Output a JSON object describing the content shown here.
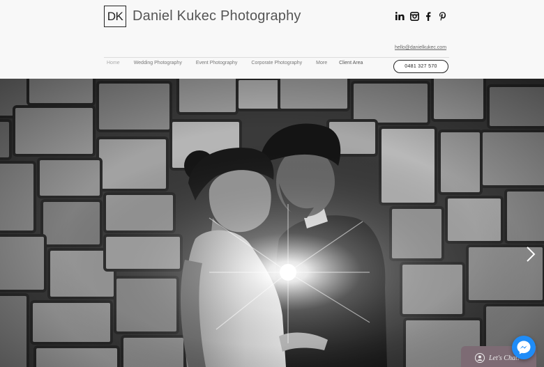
{
  "header": {
    "logo_text": "DK",
    "site_title": "Daniel Kukec Photography",
    "email": "hello@danielkukec.com",
    "phone": "0481 327 570",
    "social_icons": [
      "linkedin-icon",
      "instagram-icon",
      "facebook-icon",
      "pinterest-icon"
    ]
  },
  "nav": {
    "items": [
      {
        "label": "Home",
        "active": true
      },
      {
        "label": "Wedding Photography"
      },
      {
        "label": "Event Photography"
      },
      {
        "label": "Corporate Photography"
      },
      {
        "label": "More"
      },
      {
        "label": "Client Area"
      }
    ]
  },
  "hero": {
    "image_description": "black-and-white wedding couple photo in front of stone wall",
    "next_arrow": "chevron-right-icon"
  },
  "chat": {
    "label": "Let's Chat!"
  },
  "colors": {
    "header_bg": "#f8f8f8",
    "chat_bg": "#7d6b74",
    "messenger_blue": "#1f8cf7"
  }
}
